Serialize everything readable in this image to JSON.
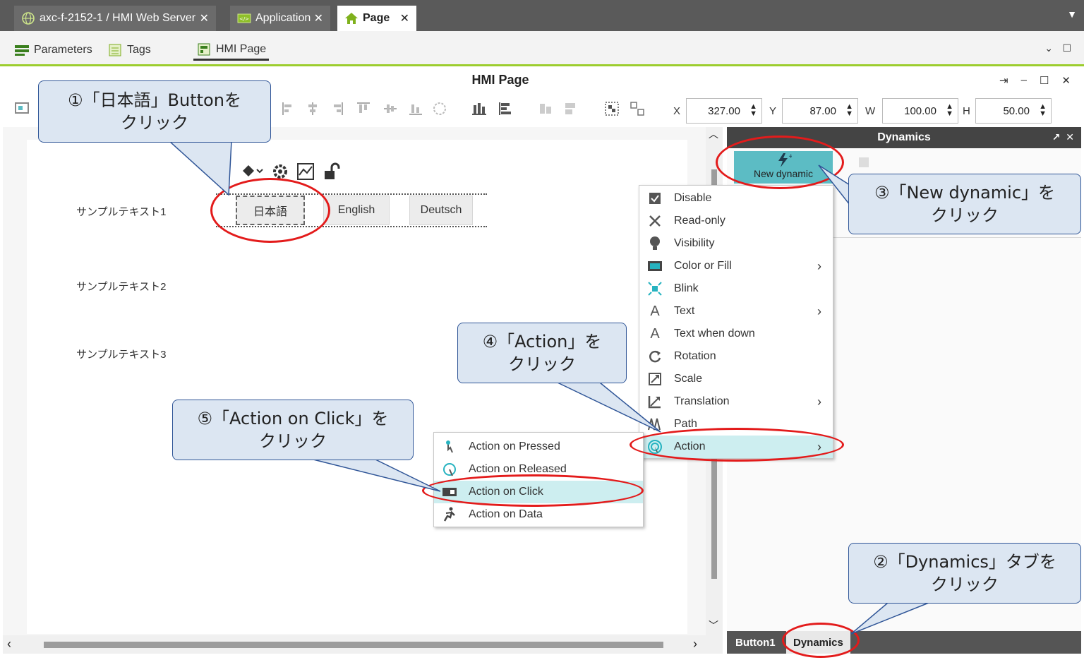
{
  "tabs": [
    {
      "label": "axc-f-2152-1 / HMI Web Server",
      "icon": "globe-icon"
    },
    {
      "label": "Application",
      "icon": "application-icon"
    },
    {
      "label": "Page",
      "icon": "home-icon"
    }
  ],
  "subtabs": [
    {
      "label": "Parameters"
    },
    {
      "label": "Tags"
    },
    {
      "label": "HMI Page"
    }
  ],
  "editor": {
    "title": "HMI Page",
    "fields": {
      "x": {
        "label": "X",
        "value": "327.00"
      },
      "y": {
        "label": "Y",
        "value": "87.00"
      },
      "w": {
        "label": "W",
        "value": "100.00"
      },
      "h": {
        "label": "H",
        "value": "50.00"
      }
    },
    "samples": [
      "サンプルテキスト1",
      "サンプルテキスト2",
      "サンプルテキスト3"
    ],
    "buttons": [
      "日本語",
      "English",
      "Deutsch"
    ]
  },
  "dynamics": {
    "title": "Dynamics",
    "new_dynamic": "New dynamic",
    "bottom_tabs": [
      "Button1",
      "Dynamics"
    ]
  },
  "menu": {
    "items": [
      {
        "label": "Disable",
        "icon": "checkbox-icon"
      },
      {
        "label": "Read-only",
        "icon": "pencil-off-icon"
      },
      {
        "label": "Visibility",
        "icon": "bulb-icon"
      },
      {
        "label": "Color or Fill",
        "icon": "fill-icon"
      },
      {
        "label": "Blink",
        "icon": "blink-icon"
      },
      {
        "label": "Text",
        "icon": "text-icon"
      },
      {
        "label": "Text when down",
        "icon": "text-down-icon"
      },
      {
        "label": "Rotation",
        "icon": "rotation-icon"
      },
      {
        "label": "Scale",
        "icon": "scale-icon"
      },
      {
        "label": "Translation",
        "icon": "translation-icon"
      },
      {
        "label": "Path",
        "icon": "path-icon"
      },
      {
        "label": "Action",
        "icon": "action-icon"
      }
    ],
    "submenu": [
      {
        "label": "Action on Pressed",
        "icon": "pressed-icon"
      },
      {
        "label": "Action on Released",
        "icon": "released-icon"
      },
      {
        "label": "Action on Click",
        "icon": "click-icon"
      },
      {
        "label": "Action on Data",
        "icon": "data-icon"
      }
    ]
  },
  "callouts": {
    "c1": [
      "①「日本語」Buttonを",
      "クリック"
    ],
    "c2": [
      "②「Dynamics」タブを",
      "クリック"
    ],
    "c3": [
      "③「New dynamic」を",
      "クリック"
    ],
    "c4": [
      "④「Action」を",
      "クリック"
    ],
    "c5": [
      "⑤「Action on Click」を",
      "クリック"
    ]
  },
  "colors": {
    "accent": "#9ccd2e",
    "highlight": "#cdeef0",
    "teal": "#5cbcc4",
    "callout_bg": "#dce6f2",
    "ring": "#e31b1b"
  }
}
